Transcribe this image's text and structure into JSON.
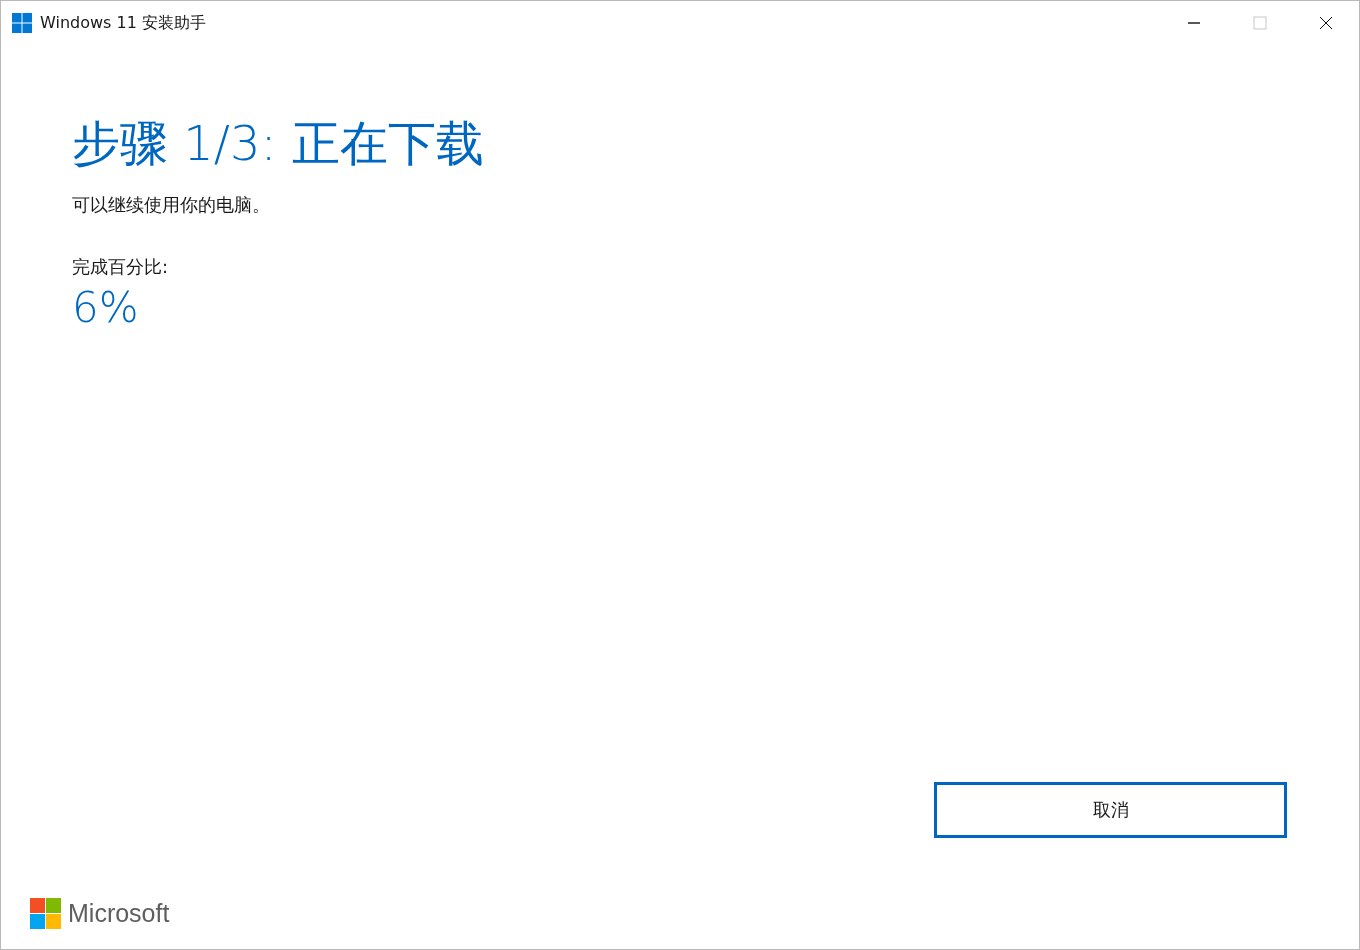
{
  "window": {
    "title": "Windows 11 安装助手",
    "controls": [
      {
        "kind": "minimize",
        "disabled": false
      },
      {
        "kind": "maximize",
        "disabled": true
      },
      {
        "kind": "close",
        "disabled": false
      }
    ]
  },
  "heading": "步骤 1/3: 正在下载",
  "subtitle": "可以继续使用你的电脑。",
  "progress": {
    "label": "完成百分比:",
    "value": "6%"
  },
  "buttons": [
    "取消"
  ],
  "footer": {
    "brand": "Microsoft"
  }
}
